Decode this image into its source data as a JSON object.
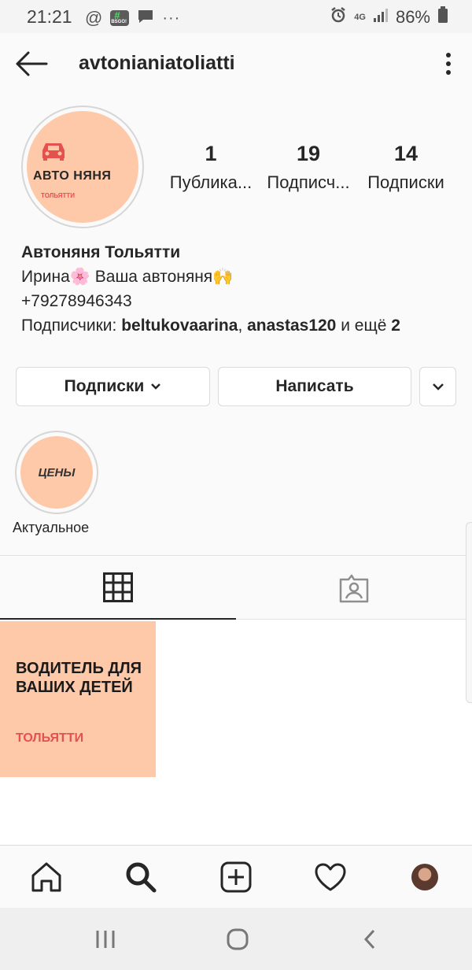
{
  "status": {
    "time": "21:21",
    "battery": "86%",
    "network": "4G",
    "left_icons": [
      "at-icon",
      "bsgo-app-icon",
      "chat-icon",
      "more-dots-icon"
    ],
    "app_badge": "BSGO!"
  },
  "header": {
    "username": "avtonianiatoliatti"
  },
  "profile": {
    "avatar": {
      "title": "АВТО НЯНЯ",
      "subtitle": "ТОЛЬЯТТИ"
    },
    "stats": [
      {
        "value": "1",
        "label": "Публика..."
      },
      {
        "value": "19",
        "label": "Подписч..."
      },
      {
        "value": "14",
        "label": "Подписки"
      }
    ],
    "name": "Автоняня Тольятти",
    "bio_line1": "Ирина🌸 Ваша автоняня🙌",
    "phone": "+79278946343",
    "followers_prefix": "Подписчики: ",
    "follower1": "beltukovaarina",
    "separator": ", ",
    "follower2": "anastas120",
    "and_more": " и ещё ",
    "more_count": "2"
  },
  "actions": {
    "following": "Подписки",
    "message": "Написать"
  },
  "highlights": [
    {
      "cover_text": "ЦЕНЫ",
      "label": "Актуальное"
    }
  ],
  "posts": [
    {
      "title": "ВОДИТЕЛЬ ДЛЯ ВАШИХ ДЕТЕЙ",
      "subtitle": "ТОЛЬЯТТИ"
    }
  ],
  "colors": {
    "peach": "#fdc9a9",
    "accent_red": "#e5514d",
    "text": "#262626",
    "border": "#dbdbdb"
  }
}
